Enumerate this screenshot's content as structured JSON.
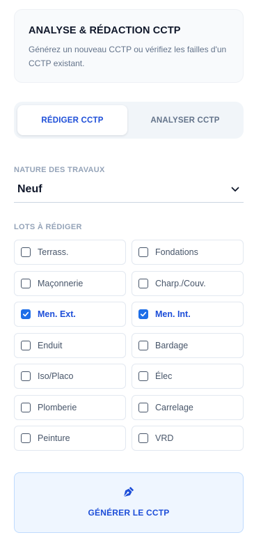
{
  "header": {
    "title": "ANALYSE & RÉDACTION CCTP",
    "subtitle": "Générez un nouveau CCTP ou vérifiez les failles d'un CCTP existant."
  },
  "tabs": [
    {
      "label": "RÉDIGER CCTP",
      "active": true
    },
    {
      "label": "ANALYSER CCTP",
      "active": false
    }
  ],
  "nature": {
    "label": "NATURE DES TRAVAUX",
    "value": "Neuf"
  },
  "lots": {
    "label": "LOTS À RÉDIGER",
    "items": [
      {
        "label": "Terrass.",
        "checked": false
      },
      {
        "label": "Fondations",
        "checked": false
      },
      {
        "label": "Maçonnerie",
        "checked": false
      },
      {
        "label": "Charp./Couv.",
        "checked": false
      },
      {
        "label": "Men. Ext.",
        "checked": true
      },
      {
        "label": "Men. Int.",
        "checked": true
      },
      {
        "label": "Enduit",
        "checked": false
      },
      {
        "label": "Bardage",
        "checked": false
      },
      {
        "label": "Iso/Placo",
        "checked": false
      },
      {
        "label": "Élec",
        "checked": false
      },
      {
        "label": "Plomberie",
        "checked": false
      },
      {
        "label": "Carrelage",
        "checked": false
      },
      {
        "label": "Peinture",
        "checked": false
      },
      {
        "label": "VRD",
        "checked": false
      }
    ]
  },
  "generate": {
    "label": "GÉNÉRER LE CCTP",
    "icon": "pen-nib-icon"
  },
  "colors": {
    "accent": "#1d4ed8",
    "checkbox": "#1d6ee8",
    "muted": "#94a3b8"
  }
}
